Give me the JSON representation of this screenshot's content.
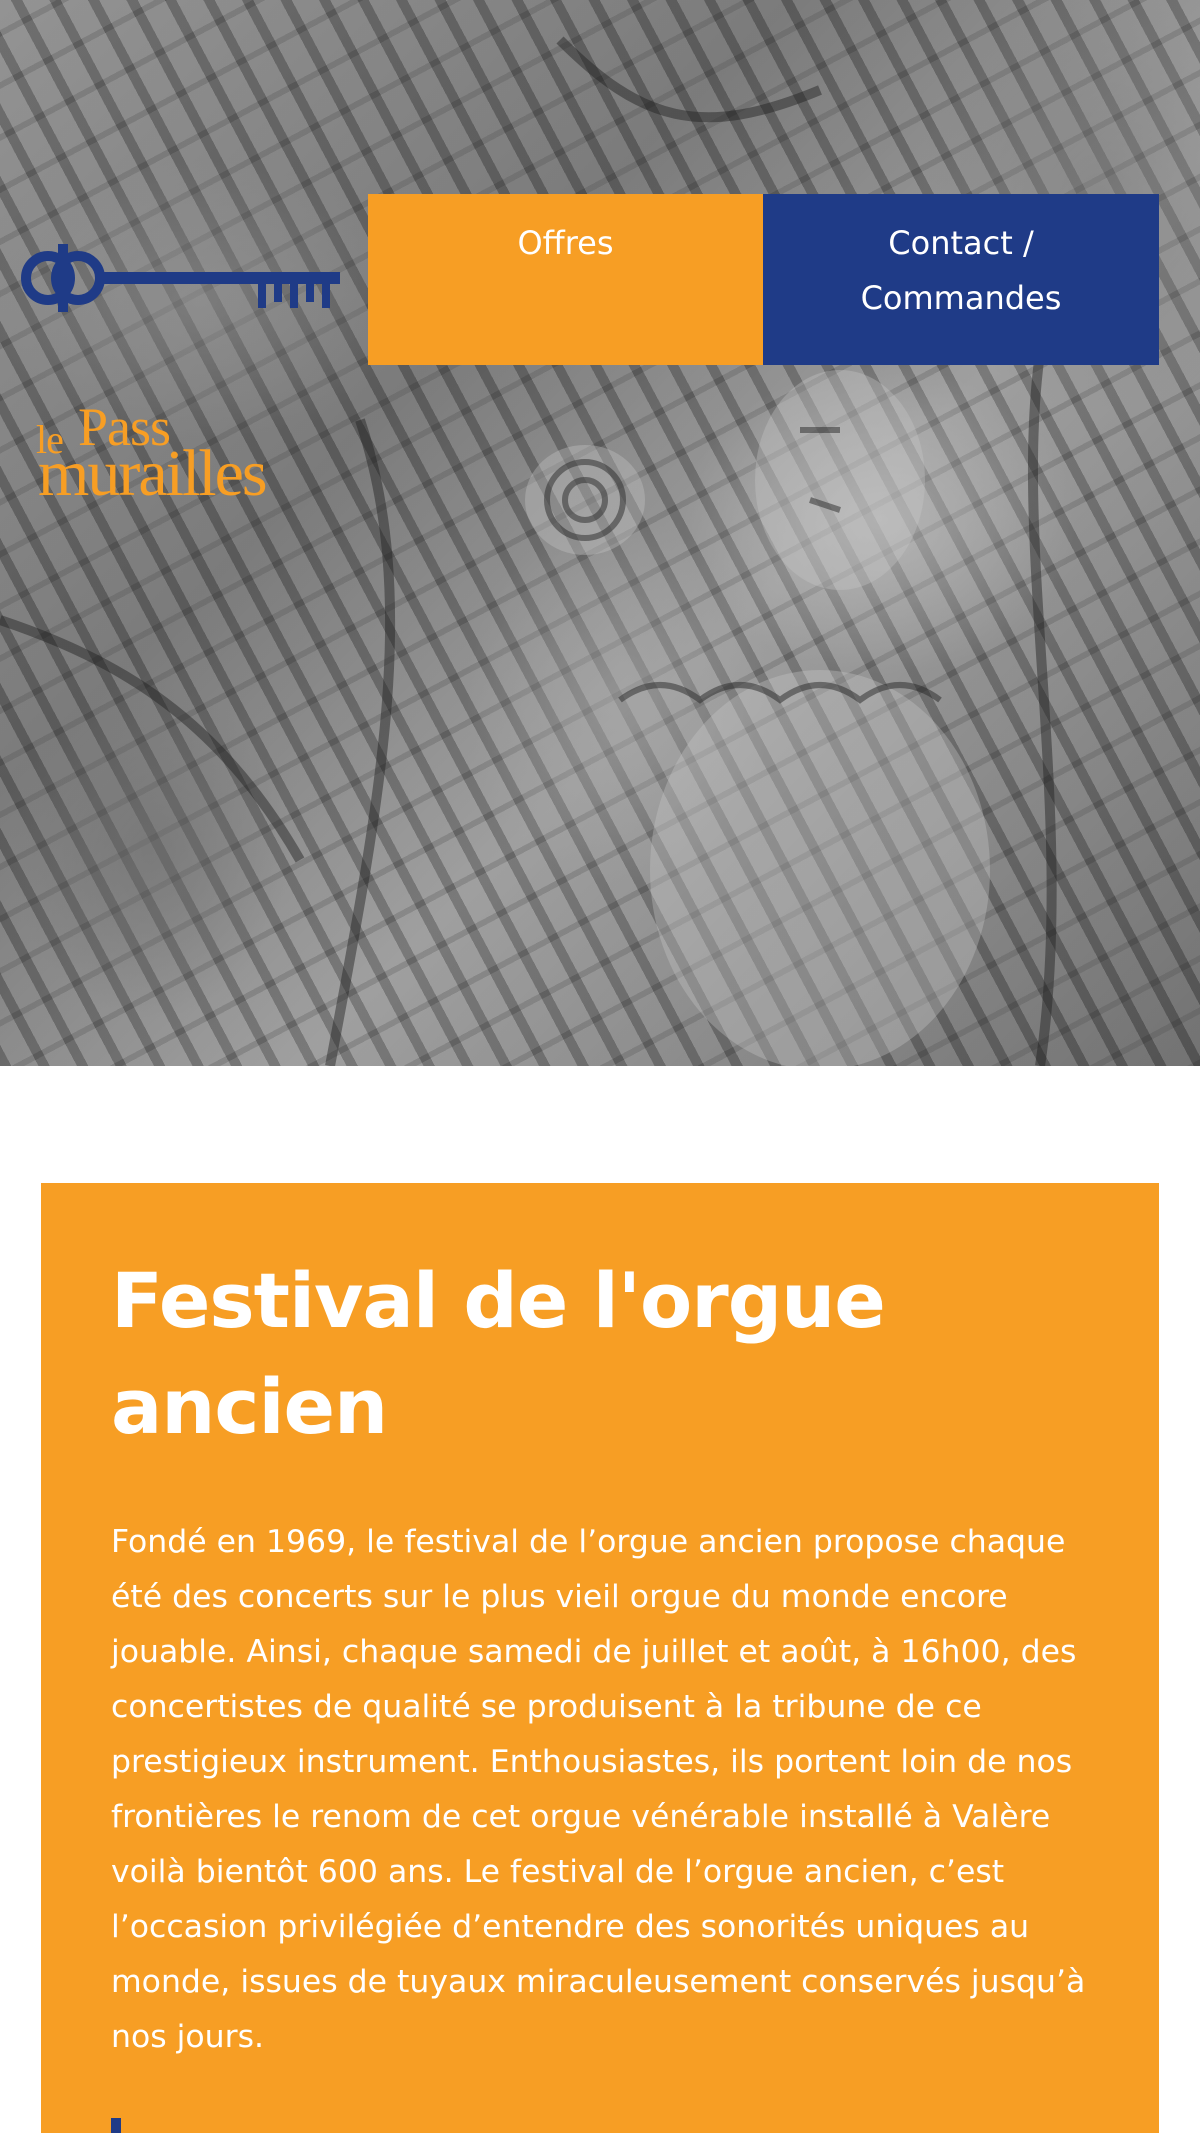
{
  "nav": {
    "items": [
      {
        "label": "Offres"
      },
      {
        "label": "Contact / Commandes"
      }
    ]
  },
  "logo": {
    "alt": "le Passe-murailles",
    "colors": {
      "key": "#1f3b87",
      "text": "#f79e24"
    }
  },
  "hero": {
    "image": "grayscale photograph of a carved stone capital"
  },
  "article": {
    "title": "Festival de l'orgue ancien",
    "body": "Fondé en 1969, le festival de l’orgue ancien propose chaque été des concerts sur le plus vieil orgue du monde encore jouable. Ainsi, chaque samedi de juillet et août, à 16h00, des concertistes de qualité se produisent à la tribune de ce prestigieux instrument. Enthousiastes, ils portent loin de nos frontières le renom de cet orgue vénérable installé à Valère voilà bientôt 600 ans. Le festival de l’orgue ancien, c’est l’occasion privilégiée d’entendre des sonorités uniques au monde, issues de tuyaux miraculeusement conservés jusqu’à nos jours."
  },
  "colors": {
    "orange": "#f79e24",
    "navy": "#1f3b87",
    "white": "#ffffff"
  }
}
